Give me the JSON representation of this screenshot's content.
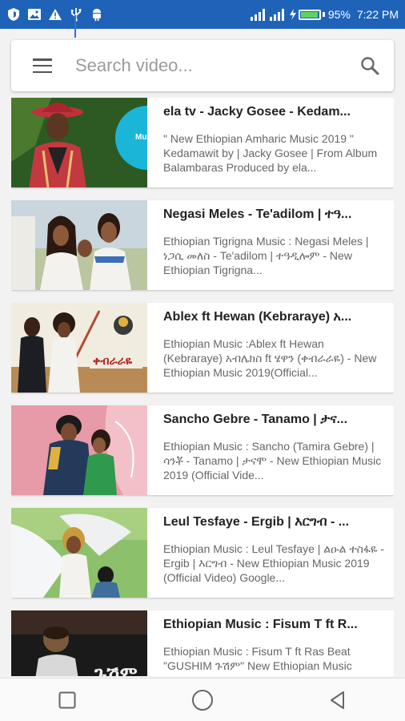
{
  "status_bar": {
    "battery_text": "95%",
    "battery_level": 0.95,
    "time": "7:22 PM",
    "bar_color": "#1f63b8"
  },
  "search": {
    "placeholder": "Search video...",
    "value": ""
  },
  "videos": [
    {
      "title": "ela tv - Jacky Gosee - Kedam...",
      "description": "\" New Ethiopian Amharic Music 2019 \" Kedamawit by | Jacky Gosee | From Album Balambaras Produced by ela...",
      "thumb_colors": [
        "#1e4d1e",
        "#c0313a",
        "#1bb5d8"
      ]
    },
    {
      "title": "Negasi Meles - Te'adilom | ተዓ...",
      "description": "Ethiopian Tigrigna Music : Negasi Meles | ነጋሲ መለስ - Te'adilom | ተዓዲሎም - New Ethiopian Tigrigna...",
      "thumb_colors": [
        "#e6e2d8",
        "#3b2418",
        "#7aa0c8"
      ]
    },
    {
      "title": "Ablex ft Hewan (Kebraraye) አ...",
      "description": "Ethiopian Music :Ablex ft Hewan (Kebraraye) አብሌክስ ft ሄዋን (ቀብራራዬ) - New Ethiopian Music 2019(Official...",
      "thumb_colors": [
        "#f0ece0",
        "#5a2e1e",
        "#d4a84a"
      ]
    },
    {
      "title": "Sancho Gebre - Tanamo | ታና...",
      "description": "Ethiopian Music : Sancho (Tamira Gebre) | ሳንቾ - Tanamo | ታናሞ - New Ethiopian Music 2019 (Official Vide...",
      "thumb_colors": [
        "#e79aa8",
        "#233a5a",
        "#2f9a4e"
      ]
    },
    {
      "title": "Leul Tesfaye - Ergib | እርግብ - ...",
      "description": "Ethiopian Music : Leul Tesfaye | ልዑል ተስፋዬ - Ergib | እርግብ - New Ethiopian Music 2019 (Official Video) Google...",
      "thumb_colors": [
        "#7ab85a",
        "#f2f2f2",
        "#3d6f9a"
      ]
    },
    {
      "title": "Ethiopian Music : Fisum T ft R...",
      "description": "Ethiopian Music : Fisum T ft Ras Beat \"GUSHIM ጉሽም\" New Ethiopian Music",
      "thumb_colors": [
        "#1a1a1a",
        "#7a5a3a",
        "#f0f0f0"
      ]
    }
  ],
  "thumb_texts": {
    "v1_badge": "Mu",
    "v3_title": "ቀብራራዬ",
    "v6_title": "ጉሽም"
  },
  "nav": {
    "recents": "square-icon",
    "home": "circle-icon",
    "back": "triangle-icon"
  }
}
